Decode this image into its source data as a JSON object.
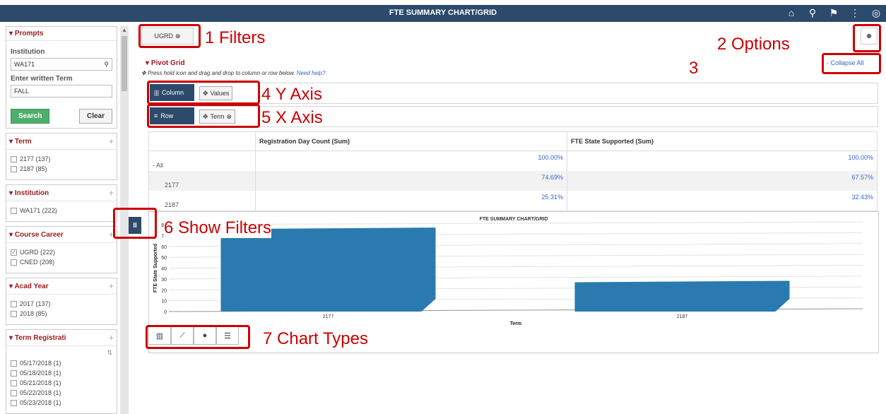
{
  "topbar": {
    "title": "FTE SUMMARY CHART/GRID",
    "icons": [
      "home-icon",
      "search-icon",
      "flag-icon",
      "more-icon",
      "compass-icon"
    ]
  },
  "sidebar": {
    "prompts": {
      "title": "Prompts",
      "institution_label": "Institution",
      "institution_value": "WA171",
      "term_label": "Enter written Term",
      "term_value": "FALL",
      "search_label": "Search",
      "clear_label": "Clear"
    },
    "facets": [
      {
        "title": "Term",
        "items": [
          {
            "label": "2177 (137)",
            "checked": false
          },
          {
            "label": "2187 (85)",
            "checked": false
          }
        ]
      },
      {
        "title": "Institution",
        "items": [
          {
            "label": "WA171 (222)",
            "checked": false
          }
        ]
      },
      {
        "title": "Course Career",
        "items": [
          {
            "label": "UGRD (222)",
            "checked": true
          },
          {
            "label": "CNED (208)",
            "checked": false
          }
        ]
      },
      {
        "title": "Acad Year",
        "items": [
          {
            "label": "2017 (137)",
            "checked": false
          },
          {
            "label": "2018 (85)",
            "checked": false
          }
        ]
      },
      {
        "title": "Term Registrati",
        "items": [
          {
            "label": "05/17/2018 (1)",
            "checked": false
          },
          {
            "label": "05/18/2018 (1)",
            "checked": false
          },
          {
            "label": "05/21/2018 (1)",
            "checked": false
          },
          {
            "label": "05/22/2018 (1)",
            "checked": false
          },
          {
            "label": "05/23/2018 (1)",
            "checked": false
          }
        ]
      }
    ]
  },
  "filter_chip": {
    "label": "UGRD"
  },
  "pivot": {
    "title": "Pivot Grid",
    "help_text": "Press hold icon and drag and drop to column or row below.",
    "help_link": "Need help?",
    "collapse_all": "- Collapse All",
    "column_tag": "Column",
    "column_chip": "Values",
    "row_tag": "Row",
    "row_chip": "Term"
  },
  "grid": {
    "headers": [
      "",
      "Registration Day Count (Sum)",
      "FTE State Supported (Sum)"
    ],
    "rows": [
      {
        "label": "- All",
        "c1": "100.00%",
        "c2": "100.00%"
      },
      {
        "label": "2177",
        "c1": "74.69%",
        "c2": "67.57%"
      },
      {
        "label": "2187",
        "c1": "25.31%",
        "c2": "32.43%"
      }
    ]
  },
  "chart_data": {
    "type": "bar",
    "title": "FTE SUMMARY CHART/GRID",
    "xlabel": "Term",
    "ylabel": "FTE State Supported",
    "categories": [
      "2177",
      "2187"
    ],
    "values": [
      76,
      27
    ],
    "yticks": [
      0,
      10,
      20,
      30,
      40,
      50,
      60,
      70,
      80
    ],
    "ylim": [
      0,
      80
    ],
    "bar_color": "#2a7ab0"
  },
  "annotations": {
    "a1": "1 Filters",
    "a2": "2 Options",
    "a3": "3",
    "a4": "4 Y Axis",
    "a5": "5 X Axis",
    "a6": "6 Show Filters",
    "a7": "7 Chart Types"
  },
  "chart_type_icons": [
    "bar-chart-icon",
    "line-chart-icon",
    "pie-chart-icon",
    "horizontal-bar-icon"
  ]
}
